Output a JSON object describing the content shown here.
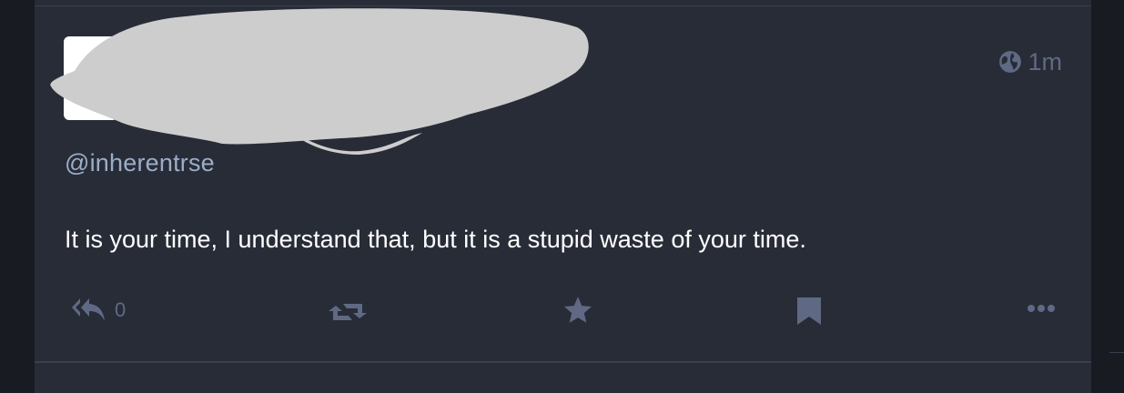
{
  "status": {
    "handle": "@inherentrse",
    "time": "1m",
    "visibility_icon": "globe-icon",
    "content": "It is your time, I understand that, but it is a stupid waste of your time."
  },
  "actions": {
    "reply_icon": "reply-all-icon",
    "reply_count": "0",
    "boost_icon": "retweet-icon",
    "favourite_icon": "star-icon",
    "bookmark_icon": "bookmark-icon",
    "more_icon": "ellipsis-icon"
  },
  "colors": {
    "background": "#191b22",
    "card": "#282c37",
    "divider": "#393f4f",
    "muted_text": "#606984",
    "handle_text": "#9baec8",
    "body_text": "#ffffff",
    "redaction": "#cdcdcd"
  }
}
